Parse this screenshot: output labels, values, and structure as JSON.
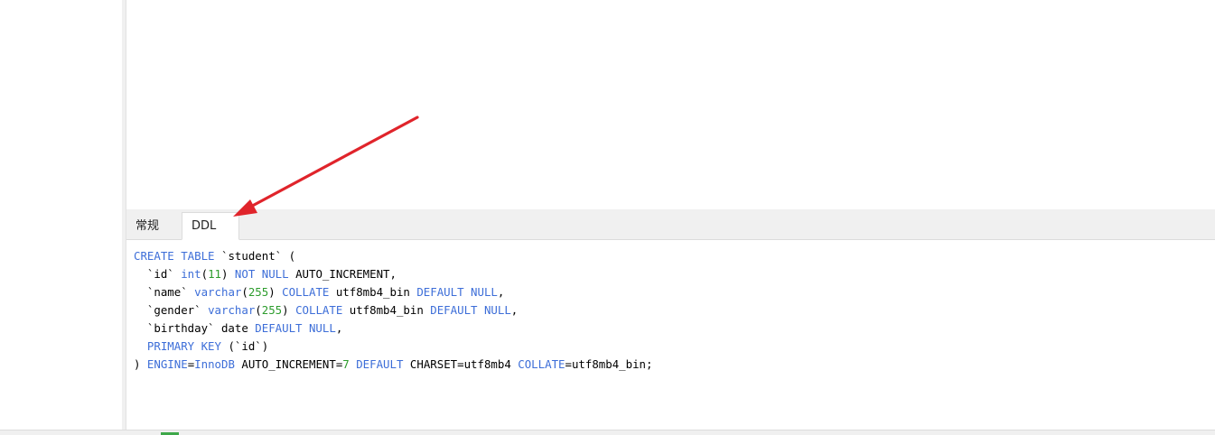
{
  "tabs": {
    "general": "常规",
    "ddl": "DDL"
  },
  "ddl": {
    "l1": {
      "kw1": "CREATE TABLE",
      "t1": " `student` ("
    },
    "l2": {
      "t0": "  `id` ",
      "kw1": "int",
      "t1": "(",
      "n1": "11",
      "t2": ") ",
      "kw2": "NOT NULL",
      "t3": " AUTO_INCREMENT,"
    },
    "l3": {
      "t0": "  `name` ",
      "kw1": "varchar",
      "t1": "(",
      "n1": "255",
      "t2": ") ",
      "kw2": "COLLATE",
      "t3": " utf8mb4_bin ",
      "kw3": "DEFAULT NULL",
      "t4": ","
    },
    "l4": {
      "t0": "  `gender` ",
      "kw1": "varchar",
      "t1": "(",
      "n1": "255",
      "t2": ") ",
      "kw2": "COLLATE",
      "t3": " utf8mb4_bin ",
      "kw3": "DEFAULT NULL",
      "t4": ","
    },
    "l5": {
      "t0": "  `birthday` date ",
      "kw1": "DEFAULT NULL",
      "t1": ","
    },
    "l6": {
      "t0": "  ",
      "kw1": "PRIMARY KEY",
      "t1": " (`id`)"
    },
    "l7": {
      "t0": ") ",
      "kw1": "ENGINE",
      "t1": "=",
      "kw2": "InnoDB",
      "t2": " AUTO_INCREMENT=",
      "n1": "7",
      "t3": " ",
      "kw3": "DEFAULT",
      "t4": " CHARSET=utf8mb4 ",
      "kw4": "COLLATE",
      "t5": "=utf8mb4_bin;"
    }
  },
  "colors": {
    "keyword": "#3d6ed8",
    "number": "#2d9c2d",
    "arrow": "#e0242b"
  },
  "icons": {
    "annotation": "red-arrow-icon",
    "bottom": "green-status-icon"
  }
}
